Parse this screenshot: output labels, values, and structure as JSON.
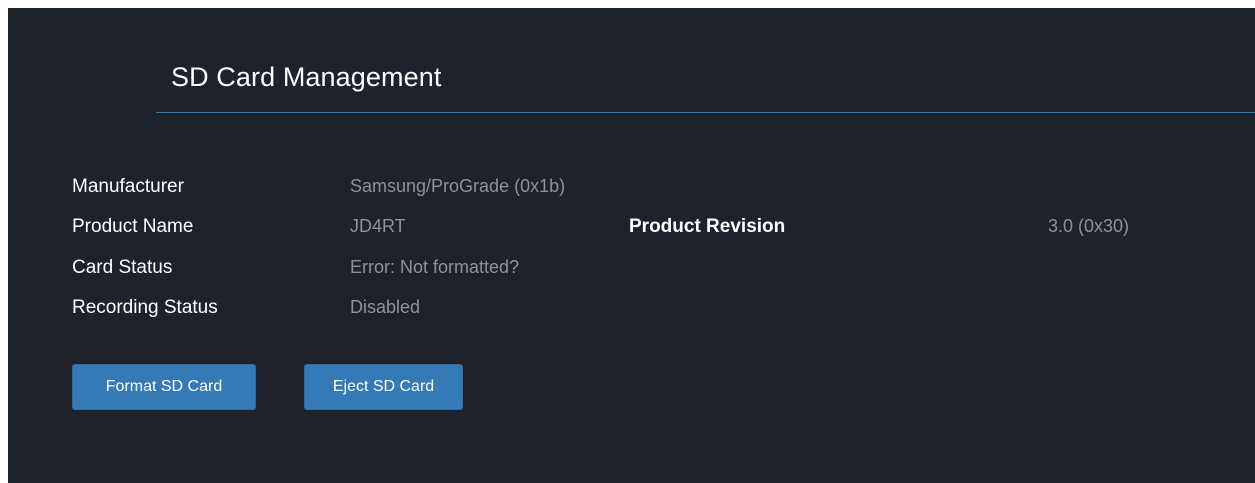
{
  "section": {
    "title": "SD Card Management"
  },
  "info": {
    "manufacturer": {
      "label": "Manufacturer",
      "value": "Samsung/ProGrade (0x1b)"
    },
    "product_name": {
      "label": "Product Name",
      "value": "JD4RT"
    },
    "product_revision": {
      "label": "Product Revision",
      "value": "3.0 (0x30)"
    },
    "card_status": {
      "label": "Card Status",
      "value": "Error: Not formatted?"
    },
    "recording_status": {
      "label": "Recording Status",
      "value": "Disabled"
    }
  },
  "actions": {
    "format_label": "Format SD Card",
    "eject_label": "Eject SD Card"
  },
  "colors": {
    "background": "#1e222b",
    "accent_rule": "#1f7ec2",
    "button": "#337ab7",
    "label_text": "#ffffff",
    "value_text": "#8e9198"
  }
}
